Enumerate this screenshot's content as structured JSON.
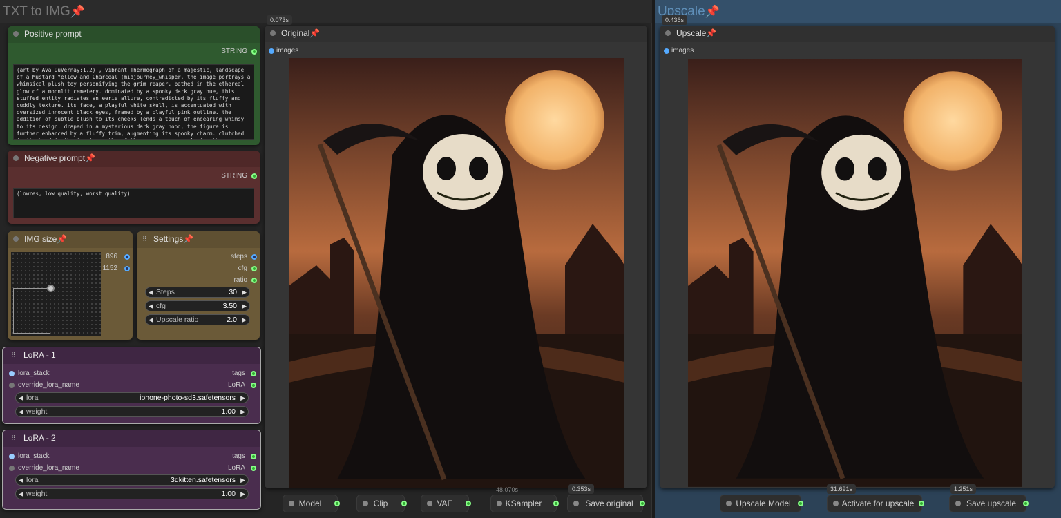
{
  "groups": {
    "txt2img": "TXT to IMG",
    "upscale": "Upscale"
  },
  "positive": {
    "title": "Positive prompt",
    "out": "STRING",
    "text": "(art by Ava DuVernay:1.2) , vibrant Thermograph of a majestic, landscape of a Mustard Yellow and Charcoal (midjourney_whisper, the image portrays a whimsical plush toy personifying the grim reaper, bathed in the ethereal glow of a moonlit cemetery. dominated by a spooky dark gray hue, this stuffed entity radiates an eerie allure, contradicted by its fluffy and cuddly texture. its face, a playful white skull, is accentuated with oversized innocent black eyes, framed by a playful pink outline. the addition of subtle blush to its cheeks lends a touch of endearing whimsy to its design. draped in a mysterious dark gray hood, the figure is further enhanced by a fluffy trim, augmenting its spooky charm. clutched in its hand is the iconic scythe of the reaper, encapsulating the"
  },
  "negative": {
    "title": "Negative prompt",
    "out": "STRING",
    "text": "(lowres, low quality, worst quality)"
  },
  "imgsize": {
    "title": "IMG size",
    "w": "896",
    "h": "1152"
  },
  "settings": {
    "title": "Settings",
    "outs": [
      "steps",
      "cfg",
      "ratio"
    ],
    "steps_label": "Steps",
    "steps": "30",
    "cfg_label": "cfg",
    "cfg": "3.50",
    "ratio_label": "Upscale ratio",
    "ratio": "2.0"
  },
  "lora1": {
    "title": "LoRA - 1",
    "in1": "lora_stack",
    "in2": "override_lora_name",
    "out1": "tags",
    "out2": "LoRA",
    "lora_label": "lora",
    "lora": "iphone-photo-sd3.safetensors",
    "weight_label": "weight",
    "weight": "1.00"
  },
  "lora2": {
    "title": "LoRA - 2",
    "in1": "lora_stack",
    "in2": "override_lora_name",
    "out1": "tags",
    "out2": "LoRA",
    "lora_label": "lora",
    "lora": "3dkitten.safetensors",
    "weight_label": "weight",
    "weight": "1.00"
  },
  "original": {
    "title": "Original",
    "input": "images",
    "timing": "0.073s"
  },
  "upscaled": {
    "title": "Upscale",
    "input": "images",
    "timing": "0.436s"
  },
  "timings": {
    "ksampler": "48.070s",
    "save_original": "0.353s",
    "activate": "31.691s",
    "save_upscale": "1.251s"
  },
  "buttons": {
    "model": "Model",
    "clip": "Clip",
    "vae": "VAE",
    "ksampler": "KSampler",
    "save_original": "Save original",
    "upscale_model": "Upscale Model",
    "activate": "Activate for upscale",
    "save_upscale": "Save upscale"
  },
  "colors": {
    "positive": "#2f5a2f",
    "negative": "#5a2f2f",
    "settings": "#6b5a38",
    "lora": "#4a2d4e",
    "upscale_group": "#2d4a63"
  }
}
